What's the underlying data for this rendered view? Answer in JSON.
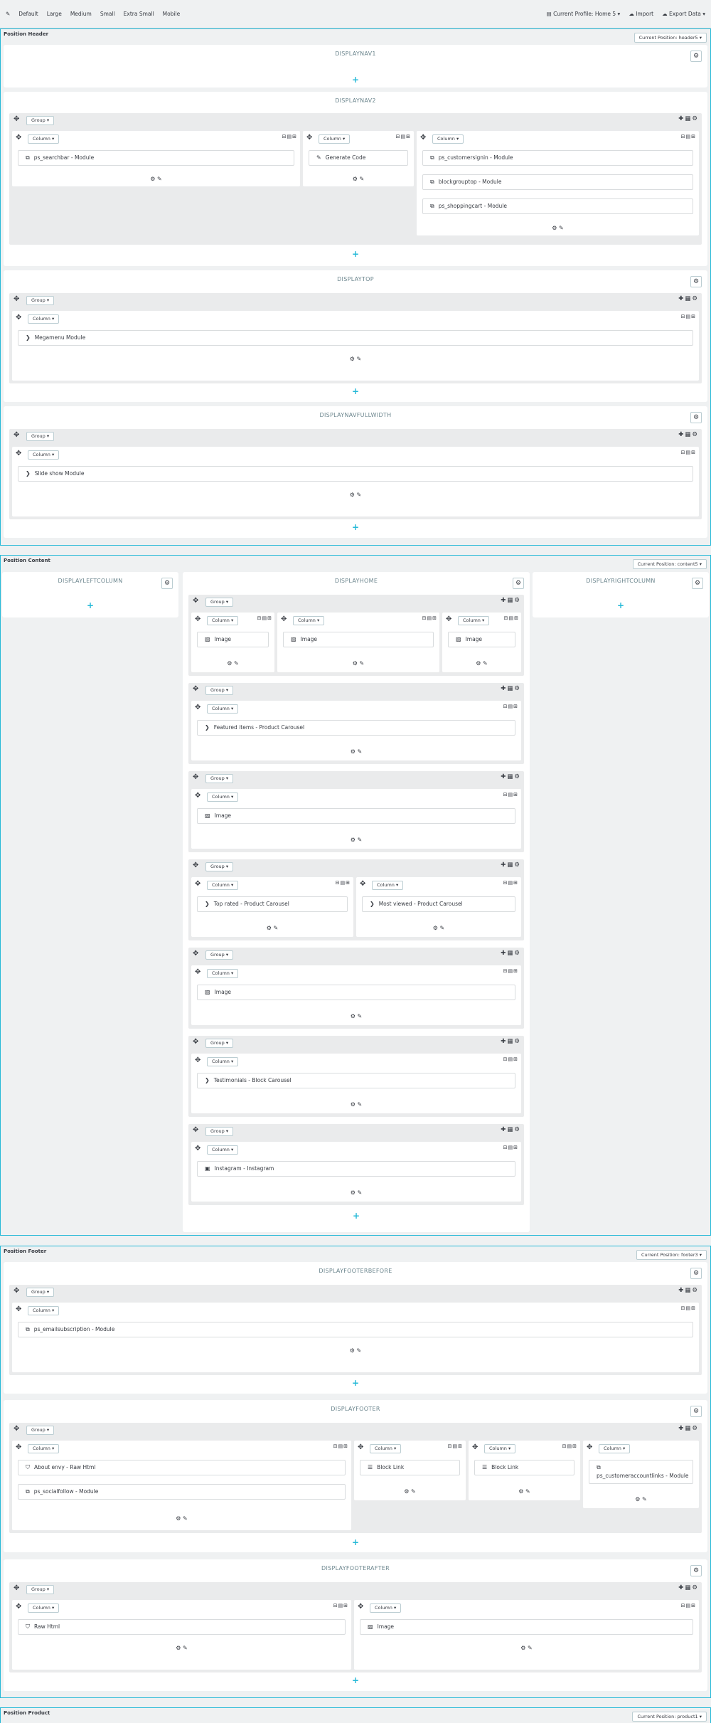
{
  "toolbar": {
    "edit_icon": "pencil-icon",
    "sizes": [
      "Default",
      "Large",
      "Medium",
      "Small",
      "Extra Small",
      "Mobile"
    ],
    "current_profile": "Current Profile: Home 5",
    "import": "Import",
    "export": "Export Data"
  },
  "positions": {
    "header": {
      "title": "Position Header",
      "current": "Current Position: header5"
    },
    "content": {
      "title": "Position Content",
      "current": "Current Position: content5"
    },
    "footer": {
      "title": "Position Footer",
      "current": "Current Position: footer3"
    },
    "product": {
      "title": "Position Product",
      "current": "Current Position: product1"
    }
  },
  "labels": {
    "group": "Group",
    "column": "Column",
    "plus": "+"
  },
  "hooks": {
    "displaynav1": "DISPLAYNAV1",
    "displaynav2": "DISPLAYNAV2",
    "displaytop": "DISPLAYTOP",
    "displaynavfullwidth": "DISPLAYNAVFULLWIDTH",
    "displayleftcolumn": "DISPLAYLEFTCOLUMN",
    "displayhome": "DISPLAYHOME",
    "displayrightcolumn": "DISPLAYRIGHTCOLUMN",
    "displayfooterbefore": "DISPLAYFOOTERBEFORE",
    "displayfooter": "DISPLAYFOOTER",
    "displayfooterafter": "DISPLAYFOOTERAFTER"
  },
  "modules": {
    "searchbar": "ps_searchbar - Module",
    "generate_code": "Generate Code",
    "customersignin": "ps_customersignin - Module",
    "blockgrouptop": "blockgrouptop - Module",
    "shoppingcart": "ps_shoppingcart - Module",
    "megamenu": "Megamenu Module",
    "slideshow": "Slide show Module",
    "image": "Image",
    "featured": "Featured items - Product Carousel",
    "top_rated": "Top rated - Product Carousel",
    "most_viewed": "Most viewed - Product Carousel",
    "testimonials": "Testimonials - Block Carousel",
    "instagram": "Instagram - Instagram",
    "emailsubscription": "ps_emailsubscription - Module",
    "about_envy": "About envy - Raw Html",
    "socialfollow": "ps_socialfollow - Module",
    "block_link": "Block Link",
    "customeraccountlinks": "ps_customeraccountlinks - Module",
    "raw_html": "Raw Html"
  }
}
